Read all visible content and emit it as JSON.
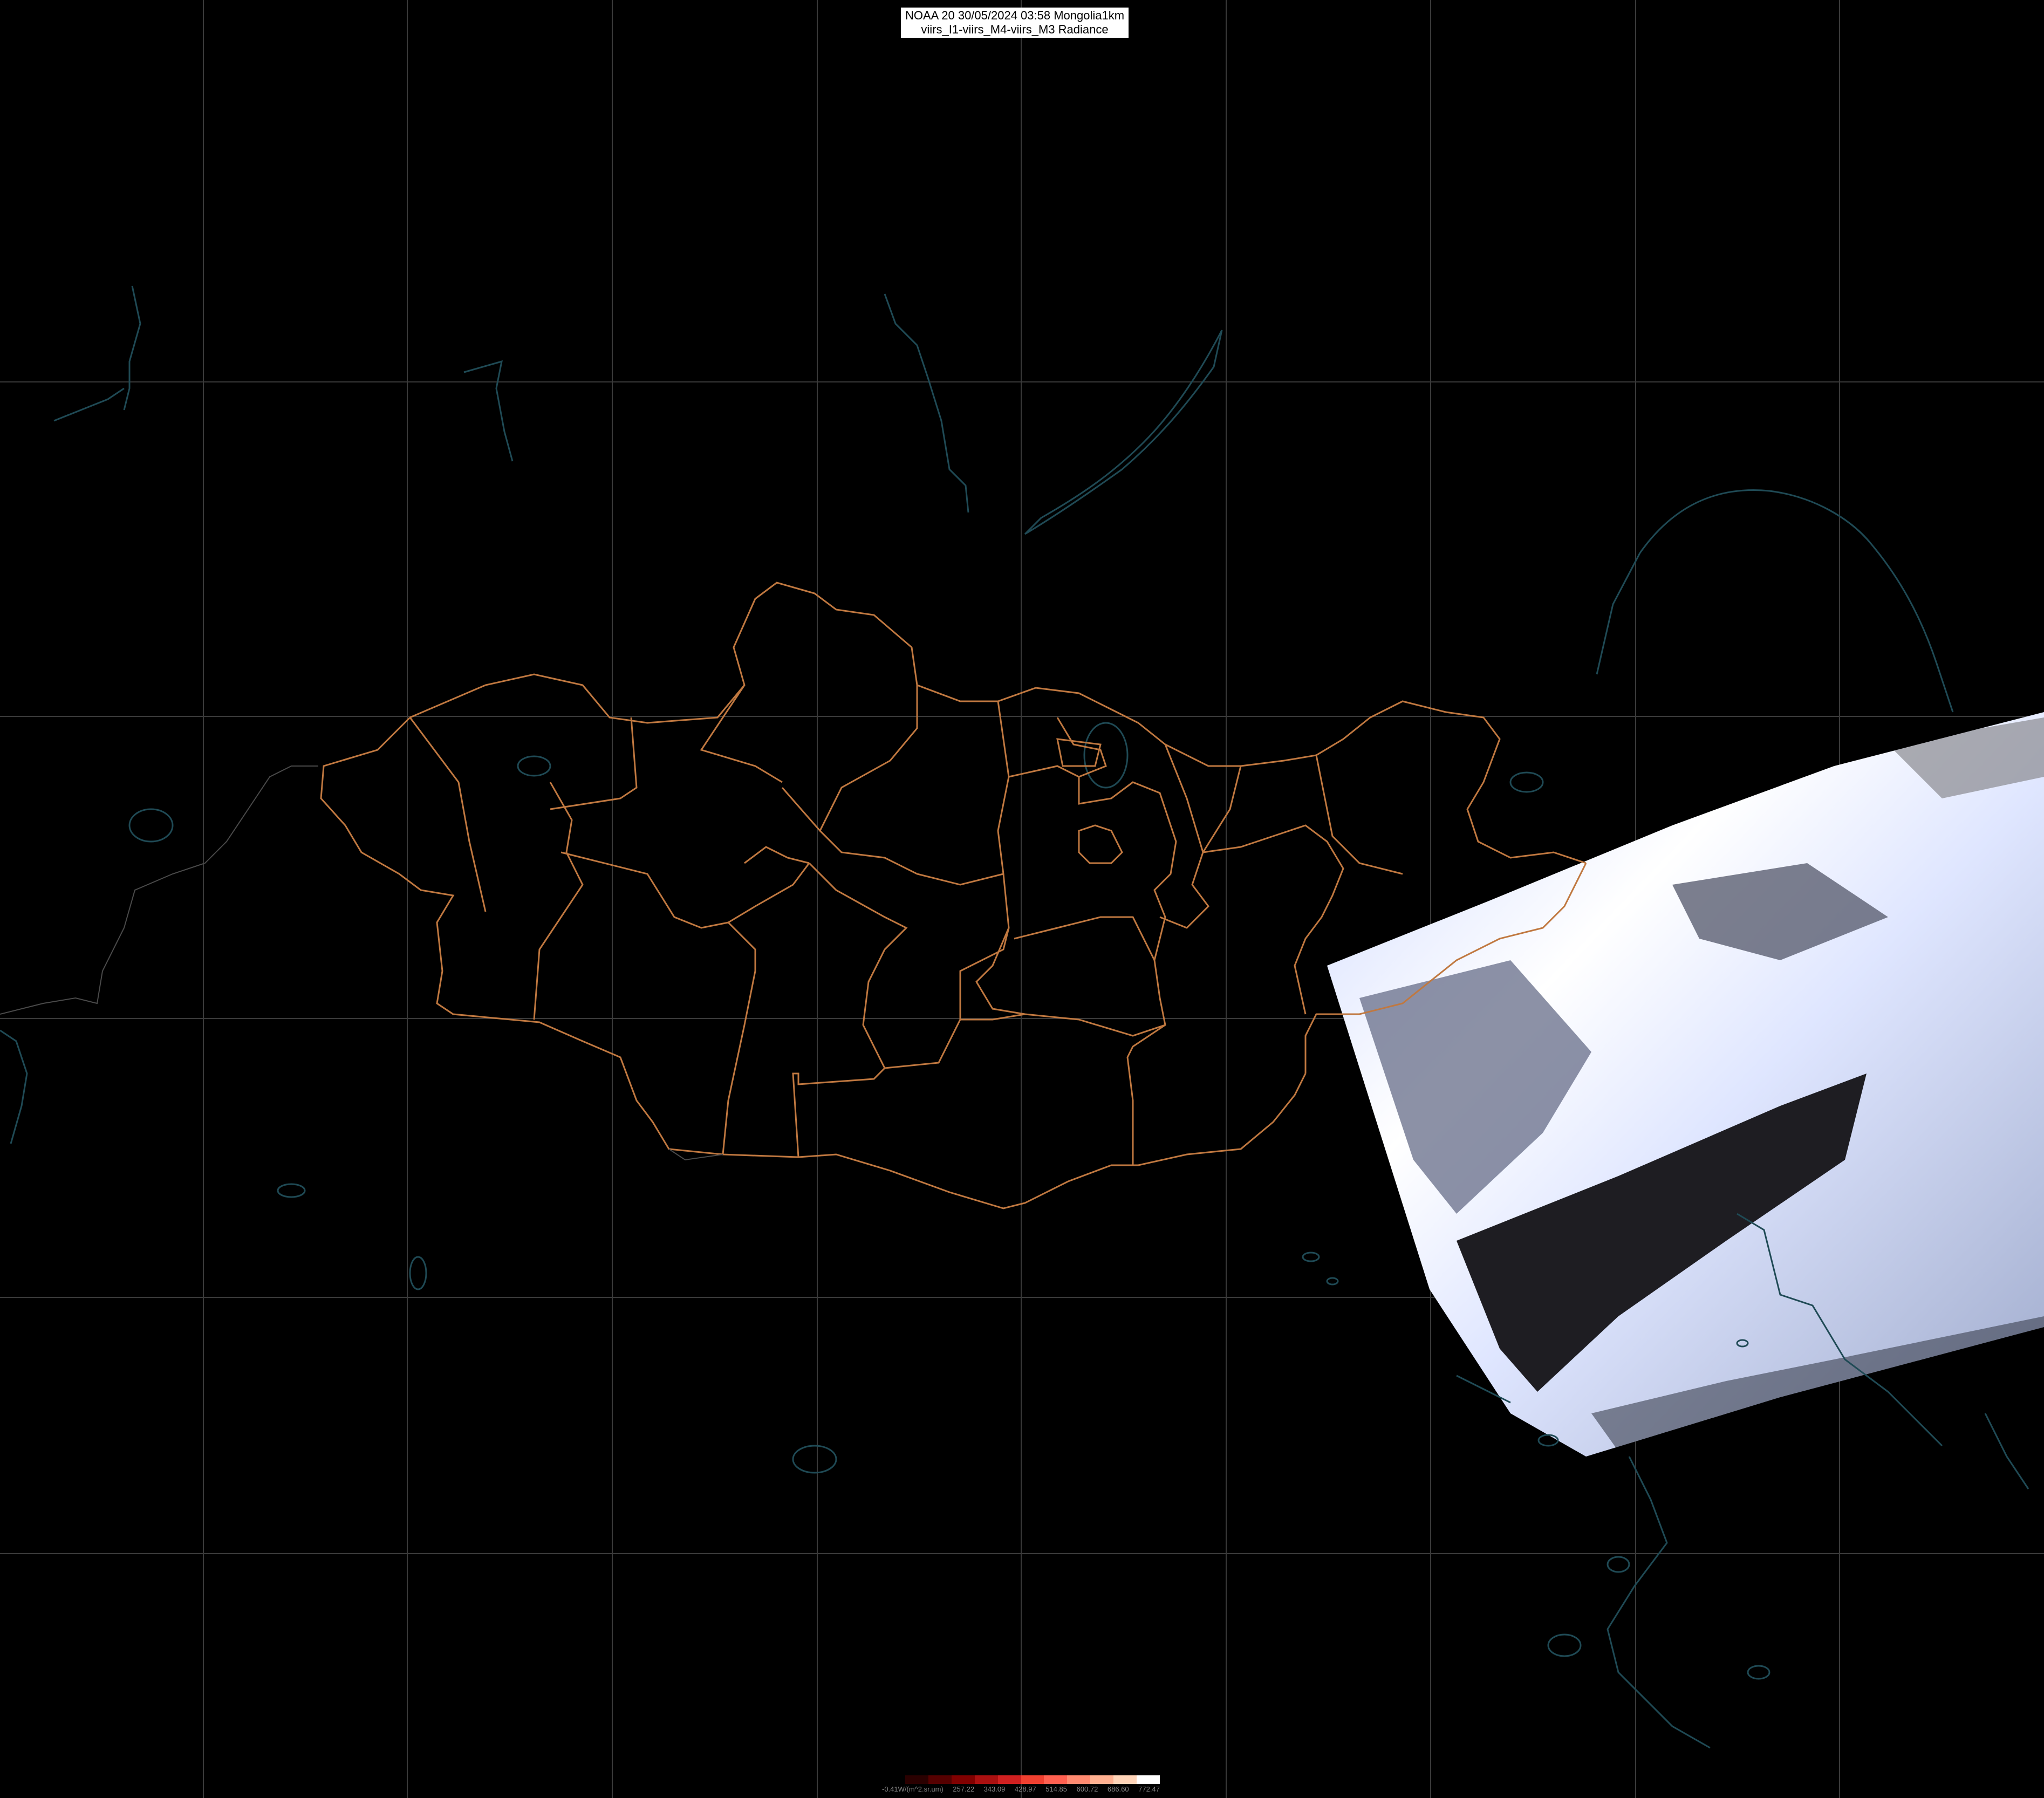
{
  "title": {
    "line1": "NOAA 20 30/05/2024 03:58 Mongolia1km",
    "line2": "viirs_I1-viirs_M4-viirs_M3 Radiance"
  },
  "legend": {
    "labels": [
      "-0.41W/(m^2.sr.um)",
      "257.22",
      "343.09",
      "428.97",
      "514.85",
      "600.72",
      "686.60",
      "772.47"
    ],
    "colors": [
      "#000000",
      "#2a0000",
      "#550000",
      "#800000",
      "#aa1010",
      "#d02020",
      "#f04030",
      "#ff6050",
      "#ff8a70",
      "#ffb090",
      "#ffd4b8",
      "#ffffff"
    ]
  },
  "colors": {
    "background": "#000000",
    "grid": "#3a3a3a",
    "admin_border": "#c07840",
    "coast_water": "#1f4a55"
  }
}
